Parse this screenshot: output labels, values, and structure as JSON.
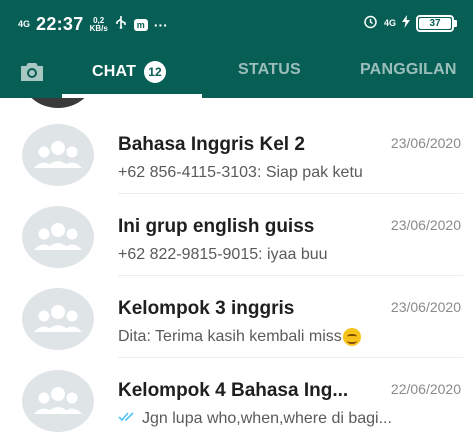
{
  "status_bar": {
    "signal_label": "4G",
    "time": "22:37",
    "speed_value": "0,2",
    "speed_unit": "KB/s",
    "usb_icon": "usb-icon",
    "app_badge": "m",
    "more": "···",
    "alarm_icon": "alarm-icon",
    "network_right": "4G",
    "battery": "37"
  },
  "tabs": {
    "camera_icon": "camera-icon",
    "chat_label": "CHAT",
    "chat_count": "12",
    "status_label": "STATUS",
    "calls_label": "PANGGILAN"
  },
  "colors": {
    "header": "#075e54",
    "avatar_bg": "#dfe5e7",
    "read_tick": "#4fc3f7"
  },
  "chats": [
    {
      "title": "Bahasa Inggris Kel 2",
      "date": "23/06/2020",
      "message": "+62 856-4115-3103: Siap pak ketu"
    },
    {
      "title": "Ini grup english guiss",
      "date": "23/06/2020",
      "message": "+62 822-9815-9015: iyaa buu"
    },
    {
      "title": "Kelompok 3 inggris",
      "date": "23/06/2020",
      "message": "Dita: Terima kasih kembali miss"
    },
    {
      "title": "Kelompok 4 Bahasa Ing...",
      "date": "22/06/2020",
      "message": "Jgn lupa who,when,where di bagi..."
    }
  ]
}
